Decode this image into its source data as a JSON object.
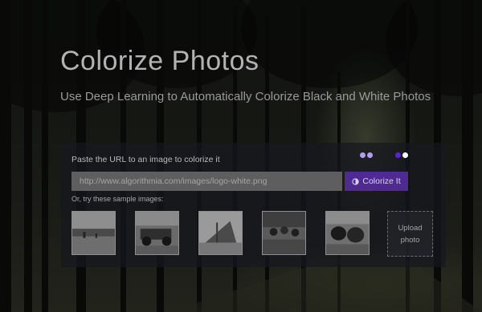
{
  "hero": {
    "title": "Colorize Photos",
    "subtitle": "Use Deep Learning to Automatically Colorize Black and White Photos"
  },
  "panel": {
    "label": "Paste the URL to an image to colorize it",
    "url_placeholder": "http://www.algorithmia.com/images/logo-white.png",
    "colorize_button": "Colorize It",
    "samples_label": "Or, try these sample images:",
    "upload_label": "Upload photo",
    "samples": [
      {
        "name": "sample-beach-photo"
      },
      {
        "name": "sample-vintage-car-photo"
      },
      {
        "name": "sample-boat-photo"
      },
      {
        "name": "sample-street-crowd-photo"
      },
      {
        "name": "sample-cows-photo"
      }
    ]
  },
  "colors": {
    "accent": "#4e2a92",
    "dots_left": [
      "#b49ef0",
      "#b49ef0"
    ],
    "dots_right": [
      "#5a22d8",
      "#ffffff"
    ]
  },
  "icons": {
    "colorize": "half-circle-icon"
  }
}
